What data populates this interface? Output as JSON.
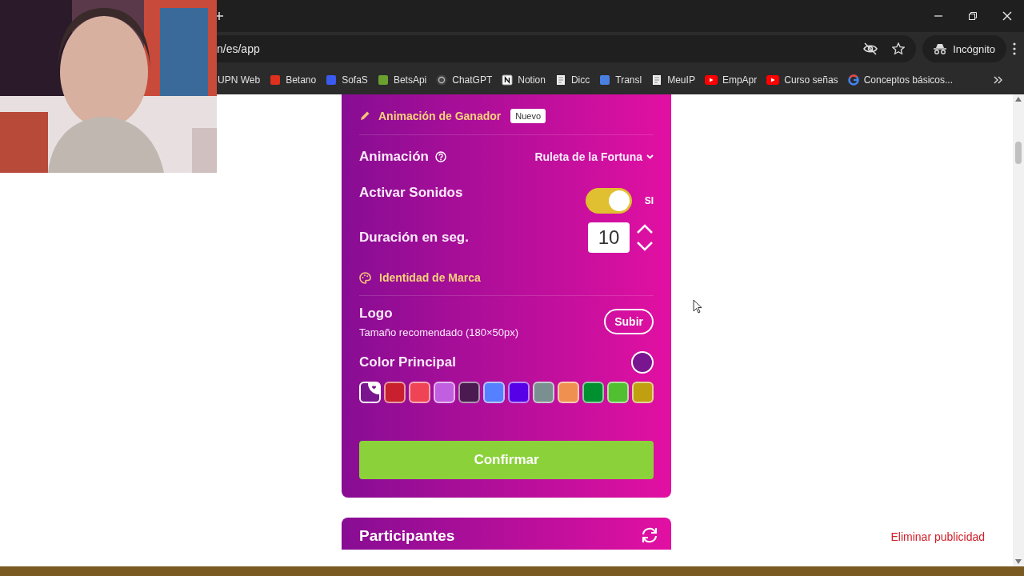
{
  "browser": {
    "address": "n/es/app",
    "incognito_label": "Incógnito",
    "bookmarks": [
      {
        "label": "UPN Web",
        "kind": "none"
      },
      {
        "label": "Betano",
        "kind": "square",
        "color": "#e0301e"
      },
      {
        "label": "SofaS",
        "kind": "square",
        "color": "#3a5af0"
      },
      {
        "label": "BetsApi",
        "kind": "square",
        "color": "#6aa030"
      },
      {
        "label": "ChatGPT",
        "kind": "circle",
        "color": "#444444"
      },
      {
        "label": "Notion",
        "kind": "notion"
      },
      {
        "label": "Dicc",
        "kind": "page"
      },
      {
        "label": "Transl",
        "kind": "square",
        "color": "#4a80e0"
      },
      {
        "label": "MeuIP",
        "kind": "page"
      },
      {
        "label": "EmpApr",
        "kind": "youtube"
      },
      {
        "label": "Curso señas",
        "kind": "youtube"
      },
      {
        "label": "Conceptos básicos...",
        "kind": "google"
      }
    ]
  },
  "settings": {
    "section_animation": {
      "title": "Animación de Ganador",
      "badge": "Nuevo"
    },
    "animation": {
      "label": "Animación",
      "value": "Ruleta de la Fortuna"
    },
    "sounds": {
      "label": "Activar Sonidos",
      "on": true,
      "state_label": "SI"
    },
    "duration": {
      "label": "Duración en seg.",
      "value": "10"
    },
    "section_brand": {
      "title": "Identidad de Marca"
    },
    "logo": {
      "label": "Logo",
      "hint": "Tamaño recomendado (180×50px)",
      "button": "Subir"
    },
    "main_color": {
      "label": "Color Principal",
      "color": "#7a1590"
    },
    "swatches": [
      {
        "color": "#7a1590",
        "selected": true
      },
      {
        "color": "#c8202e",
        "selected": false
      },
      {
        "color": "#ee4455",
        "selected": false
      },
      {
        "color": "#c060e0",
        "selected": false
      },
      {
        "color": "#4a1a50",
        "selected": false
      },
      {
        "color": "#5580ff",
        "selected": false
      },
      {
        "color": "#5500e6",
        "selected": false
      },
      {
        "color": "#7a9090",
        "selected": false
      },
      {
        "color": "#f09050",
        "selected": false
      },
      {
        "color": "#009030",
        "selected": false
      },
      {
        "color": "#50c030",
        "selected": false
      },
      {
        "color": "#c0a010",
        "selected": false
      }
    ],
    "confirm": "Confirmar"
  },
  "participants": {
    "title": "Participantes"
  },
  "ad_link": "Eliminar publicidad"
}
